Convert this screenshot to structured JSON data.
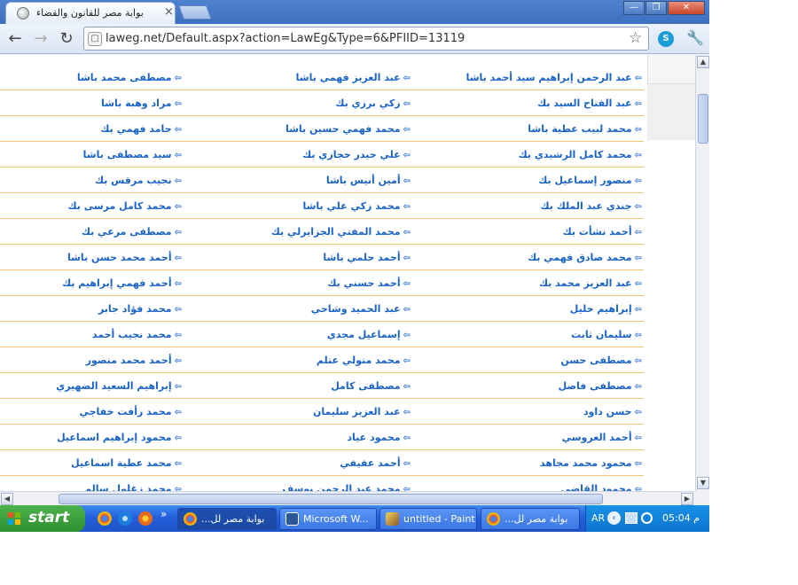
{
  "browser": {
    "tab_title": "بوابة مصر للقانون والقضاء",
    "tab_close": "×",
    "window_controls": {
      "minimize": "—",
      "restore": "❐",
      "close": "✕"
    },
    "nav": {
      "back": "←",
      "forward": "→",
      "reload": "↻"
    },
    "url": "laweg.net/Default.aspx?action=LawEg&Type=6&PFIID=13119",
    "star": "☆",
    "extension_icon": "S",
    "menu_icon": "wrench-icon"
  },
  "list": {
    "arrow_glyph": "⇦",
    "rows": [
      [
        "عبد الرحمن إبراهيم سيد أحمد باشا",
        "عبد العزيز فهمي باشا",
        "مصطفى محمد باشا"
      ],
      [
        "عبد الفتاح السيد بك",
        "زكي برزي بك",
        "مراد وهبة باشا"
      ],
      [
        "محمد لبيب عطية باشا",
        "محمد فهمي حسين باشا",
        "حامد فهمي بك"
      ],
      [
        "محمد كامل الرشيدي بك",
        "علي حيدر حجازي بك",
        "سيد مصطفى باشا"
      ],
      [
        "منصور إسماعيل بك",
        "أمين أنيس باشا",
        "نجيب مرقس بك"
      ],
      [
        "جندي عبد الملك بك",
        "محمد زكي علي باشا",
        "محمد كامل مرسى بك"
      ],
      [
        "أحمد نشأت بك",
        "محمد المفتي الجزايرلي بك",
        "مصطفى مرعي بك"
      ],
      [
        "محمد صادق فهمي بك",
        "أحمد حلمي باشا",
        "أحمد محمد حسن باشا"
      ],
      [
        "عبد العزيز محمد بك",
        "أحمد حسني بك",
        "أحمد فهمي إبراهيم بك"
      ],
      [
        "إبراهيم خليل",
        "عبد الحميد وشاحي",
        "محمد فؤاد جابر"
      ],
      [
        "سليمان ثابت",
        "إسماعيل مجدي",
        "محمد نجيب أحمد"
      ],
      [
        "مصطفى حسن",
        "محمد متولي عتلم",
        "أحمد محمد منصور"
      ],
      [
        "مصطفى فاضل",
        "مصطفى كامل",
        "إبراهيم السعيد الضهيري"
      ],
      [
        "حسن داود",
        "عبد العزيز سليمان",
        "محمد رأفت خفاجي"
      ],
      [
        "أحمد العروسي",
        "محمود عياد",
        "محمود إبراهيم اسماعيل"
      ],
      [
        "محمود محمد مجاهد",
        "أحمد عفيفي",
        "محمد عطية اسماعيل"
      ],
      [
        "محمود القاضي",
        "محمد عبد الرحمن يوسف",
        "محمد زغلول سالم"
      ]
    ]
  },
  "scrollbars": {
    "up": "▲",
    "down": "▼",
    "left": "◀",
    "right": "▶"
  },
  "taskbar": {
    "start_label": "start",
    "tasks": [
      {
        "label": "بوابة مصر لل...",
        "icon": "chrome-icon"
      },
      {
        "label": "Microsoft W...",
        "icon": "word-icon"
      },
      {
        "label": "untitled - Paint",
        "icon": "paint-icon"
      },
      {
        "label": "بوابة مصر لل...",
        "icon": "chrome-icon"
      }
    ],
    "overflow": "»",
    "language": "AR",
    "clock": "05:04 م"
  },
  "colors": {
    "link": "#1a63c7",
    "row_border": "#f6c67b",
    "taskbar": "#245edb",
    "start": "#3a9b3a"
  }
}
